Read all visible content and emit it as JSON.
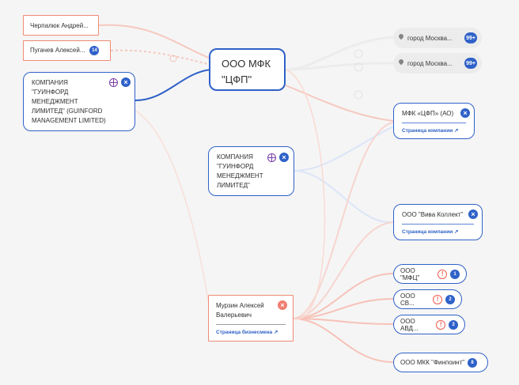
{
  "nodes": {
    "main_company": {
      "line1": "ООО МФК",
      "line2": "\"ЦФП\""
    },
    "person_chernyalyuk": {
      "label": "Черпалюк Андрей..."
    },
    "person_pugachev": {
      "label": "Пугачев Алексей...",
      "count": "14"
    },
    "company_guinford_top": {
      "line1": "КОМПАНИЯ",
      "line2": "\"ГУИНФОРД",
      "line3": "МЕНЕДЖМЕНТ",
      "line4": "ЛИМИТЕД\" (GUINFORD",
      "line5": "MANAGEMENT LIMITED)"
    },
    "company_guinford_mid": {
      "line1": "КОМПАНИЯ",
      "line2": "\"ГУИНФОРД",
      "line3": "МЕНЕДЖМЕНТ",
      "line4": "ЛИМИТЕД\""
    },
    "address_1": {
      "label": "город Москва...",
      "count": "99+"
    },
    "address_2": {
      "label": "город Москва...",
      "count": "99+"
    },
    "company_mfk_cfp_ao": {
      "label": "МФК «ЦФП» (АО)",
      "link": "Страница компании"
    },
    "company_viva": {
      "label": "ООО \"Вива Коллект\"",
      "link": "Страница компании"
    },
    "company_mfc": {
      "label": "ООО \"МФЦ\"",
      "warning": "!",
      "count": "1"
    },
    "company_sv": {
      "label": "ООО СВ...",
      "warning": "!",
      "count": "2"
    },
    "company_avd": {
      "label": "ООО АВД...",
      "warning": "!",
      "count": "3"
    },
    "person_murzin": {
      "line1": "Мурзин Алексей",
      "line2": "Валерьевич",
      "link": "Страница бизнесмена"
    },
    "company_finpoint": {
      "label": "ООО МКК \"Финпоинт\"",
      "count": "8"
    }
  },
  "colors": {
    "company_border": "#2f61c8",
    "person_border": "#f08b72",
    "badge": "#2f61c8",
    "warning": "#ee5d4f",
    "background": "#f5f5f5",
    "pill_background": "#ececec",
    "edge_pink": "#f7c2b8",
    "edge_blue": "#cddcf7"
  },
  "icons": {
    "close": "close-icon",
    "globe": "globe-icon",
    "location": "location-pin-icon",
    "warning": "warning-icon",
    "arrow_link": "share-arrow-icon"
  }
}
